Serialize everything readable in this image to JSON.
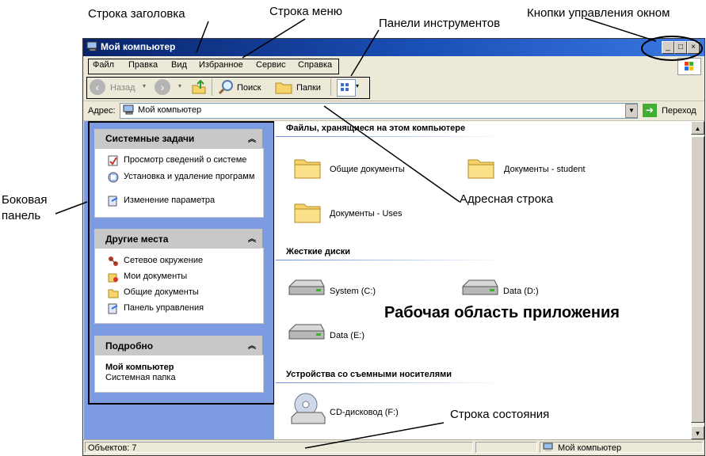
{
  "window": {
    "title": "Мой компьютер"
  },
  "menu": {
    "items": [
      "Файл",
      "Правка",
      "Вид",
      "Избранное",
      "Сервис",
      "Справка"
    ]
  },
  "toolbar": {
    "back": "Назад",
    "search": "Поиск",
    "folders": "Папки"
  },
  "address": {
    "label": "Адрес:",
    "value": "Мой компьютер",
    "go": "Переход"
  },
  "sidebar": {
    "panels": [
      {
        "title": "Системные задачи",
        "items": [
          "Просмотр сведений о системе",
          "Установка и удаление программ",
          "Изменение параметра"
        ]
      },
      {
        "title": "Другие места",
        "items": [
          "Сетевое окружение",
          "Мои документы",
          "Общие документы",
          "Панель управления"
        ]
      },
      {
        "title": "Подробно",
        "detail_title": "Мой компьютер",
        "detail_sub": "Системная папка"
      }
    ]
  },
  "content": {
    "sections": [
      {
        "title": "Файлы, хранящиеся на этом компьютере",
        "items": [
          "Общие документы",
          "Документы - student",
          "Документы - Uses"
        ]
      },
      {
        "title": "Жесткие диски",
        "items": [
          "System (C:)",
          "Data (D:)",
          "Data (E:)"
        ]
      },
      {
        "title": "Устройства со съемными носителями",
        "items": [
          "CD-дисковод (F:)"
        ]
      }
    ]
  },
  "status": {
    "objects": "Объектов: 7",
    "location": "Мой компьютер"
  },
  "annotations": {
    "title_bar": "Строка заголовка",
    "menu_bar": "Строка меню",
    "toolbars": "Панели инструментов",
    "window_buttons": "Кнопки управления окном",
    "side_panel_line1": "Боковая",
    "side_panel_line2": "панель",
    "address_bar": "Адресная строка",
    "workspace": "Рабочая область приложения",
    "status_bar": "Строка состояния"
  },
  "colors": {
    "title_gradient_start": "#0a246a",
    "title_gradient_end": "#3a78e0",
    "sidebar_bg": "#7c9be0",
    "go_green": "#3fae32"
  }
}
